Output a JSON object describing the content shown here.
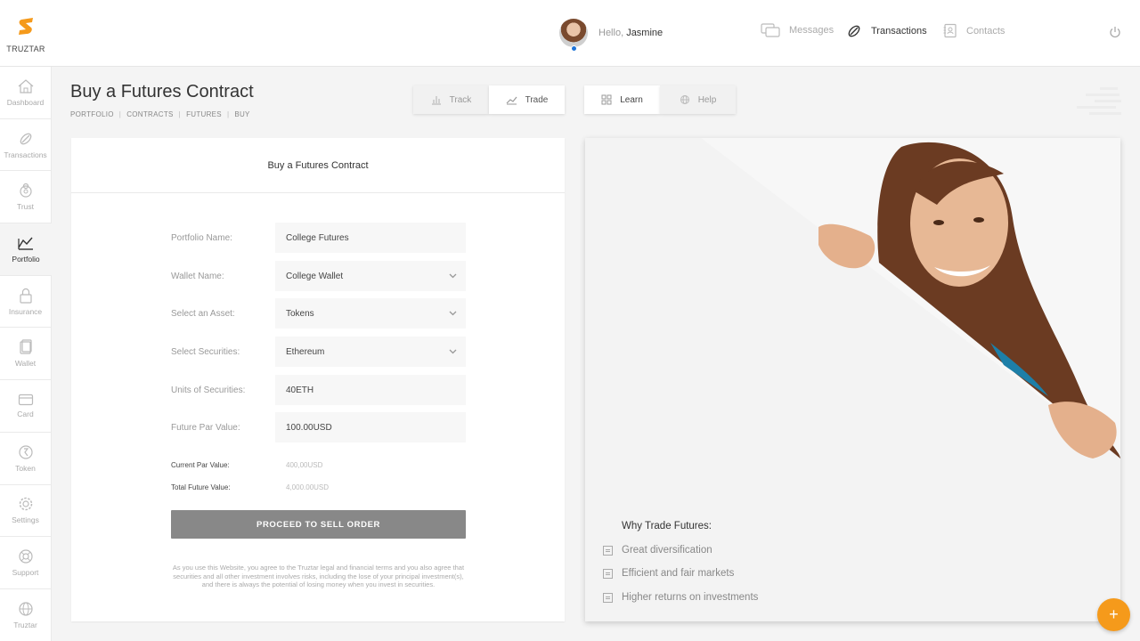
{
  "brand": {
    "name": "TRUZTAR",
    "accent": "#f59a1b"
  },
  "header": {
    "greeting": "Hello,",
    "user_name": "Jasmine",
    "nav": [
      {
        "label": "Messages",
        "icon": "messages-icon"
      },
      {
        "label": "Transactions",
        "icon": "transactions-icon"
      },
      {
        "label": "Contacts",
        "icon": "contacts-icon"
      }
    ],
    "power_icon": "power-icon"
  },
  "sidebar": {
    "items": [
      {
        "label": "Dashboard",
        "icon": "home-icon"
      },
      {
        "label": "Transactions",
        "icon": "transactions-icon"
      },
      {
        "label": "Trust",
        "icon": "trust-icon"
      },
      {
        "label": "Portfolio",
        "icon": "portfolio-icon",
        "active": true
      },
      {
        "label": "Insurance",
        "icon": "lock-icon"
      },
      {
        "label": "Wallet",
        "icon": "wallet-icon"
      },
      {
        "label": "Card",
        "icon": "card-icon"
      },
      {
        "label": "Token",
        "icon": "token-icon"
      },
      {
        "label": "Settings",
        "icon": "gear-icon"
      },
      {
        "label": "Support",
        "icon": "support-icon"
      },
      {
        "label": "Truztar",
        "icon": "globe-icon"
      }
    ]
  },
  "page": {
    "title": "Buy a Futures Contract",
    "breadcrumb": [
      "PORTFOLIO",
      "CONTRACTS",
      "FUTURES",
      "BUY"
    ],
    "breadcrumb_separator": "|"
  },
  "tabs": [
    {
      "label": "Track",
      "icon": "bar-chart-icon"
    },
    {
      "label": "Trade",
      "icon": "trend-icon"
    },
    {
      "label": "Learn",
      "icon": "grid-icon"
    },
    {
      "label": "Help",
      "icon": "globe-icon"
    }
  ],
  "form": {
    "heading": "Buy a Futures Contract",
    "fields": [
      {
        "label": "Portfolio Name:",
        "value": "College Futures"
      },
      {
        "label": "Wallet Name:",
        "value": "College Wallet"
      },
      {
        "label": "Select an Asset:",
        "value": "Tokens"
      },
      {
        "label": "Select Securities:",
        "value": "Ethereum"
      },
      {
        "label": "Units of Securities:",
        "value": "40ETH"
      },
      {
        "label": "Future Par Value:",
        "value": "100.00USD"
      }
    ],
    "current_par_label": "Current Par Value:",
    "current_par_value": "400,00USD",
    "total_future_label": "Total Future Value:",
    "total_future_value": "4,000.00USD",
    "submit_label": "PROCEED TO SELL ORDER",
    "disclaimer": "As you use this Website, you agree to the Truztar legal and financial terms and you also agree that securities and all other investment involves risks, including the lose of your principal investment(s), and there is always the potential of losing money when you invest in securities."
  },
  "promo": {
    "title": "Why Trade Futures:",
    "items": [
      "Great diversification",
      "Efficient and fair markets",
      "Higher returns on investments"
    ]
  },
  "fab": {
    "label": "+"
  }
}
